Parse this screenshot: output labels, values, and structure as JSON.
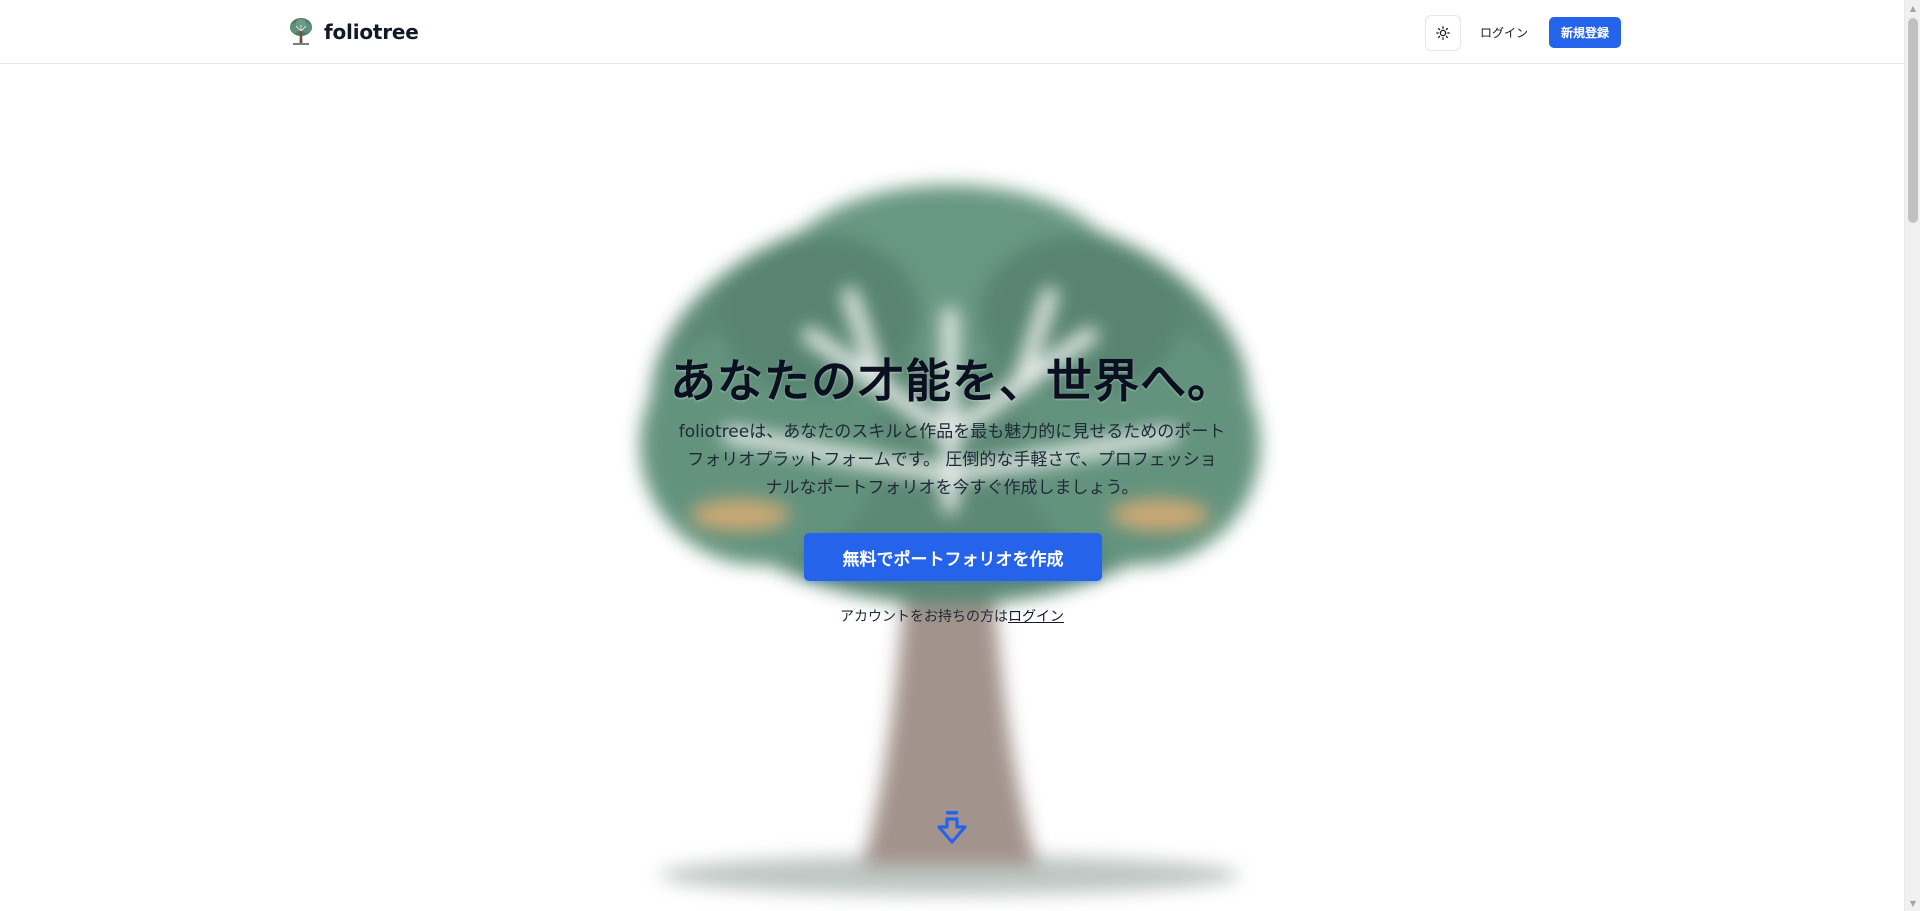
{
  "header": {
    "brand": "foliotree",
    "logo_icon": "tree-icon",
    "theme_icon": "sun-icon",
    "login_label": "ログイン",
    "signup_label": "新規登録"
  },
  "hero": {
    "title": "あなたの才能を、世界へ。",
    "description_lines": [
      "foliotreeは、あなたのスキルと作品を最も魅力的に見せるためのポート",
      "フォリオプラットフォームです。 圧倒的な手軽さで、プロフェッショ",
      "ナルなポートフォリオを今すぐ作成しましょう。"
    ],
    "cta_label": "無料でポートフォリオを作成",
    "account_prompt": "アカウントをお持ちの方は",
    "account_link": "ログイン",
    "scroll_icon": "arrow-down-icon"
  },
  "colors": {
    "accent": "#2563eb",
    "text": "#0f172a",
    "border": "#e5e7eb"
  }
}
